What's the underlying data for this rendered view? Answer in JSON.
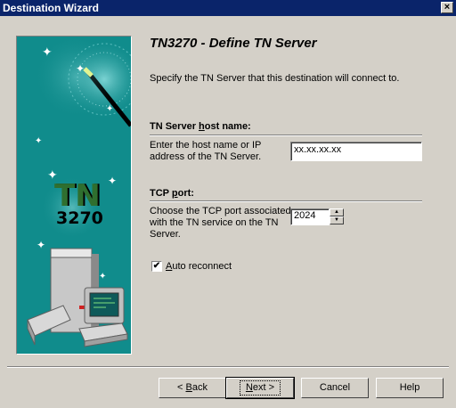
{
  "window": {
    "title": "Destination Wizard",
    "close_label": "×"
  },
  "page": {
    "heading": "TN3270 - Define TN Server",
    "intro": "Specify the TN Server that this destination will connect to."
  },
  "art": {
    "logo_line1": "TN",
    "logo_line2": "3270"
  },
  "host_section": {
    "title_pre": "TN Server ",
    "title_accel": "h",
    "title_post": "ost name:",
    "desc_line1": "Enter the host name or IP",
    "desc_line2": "address of the TN Server.",
    "value": "xx.xx.xx.xx"
  },
  "port_section": {
    "title_pre": "TCP ",
    "title_accel": "p",
    "title_post": "ort:",
    "desc_line1": "Choose the TCP port associated",
    "desc_line2": "with the TN service on the TN",
    "desc_line3": "Server.",
    "value": "2024"
  },
  "auto_reconnect": {
    "checked": true,
    "label_accel": "A",
    "label_rest": "uto reconnect"
  },
  "buttons": {
    "back_arrow": "< ",
    "back_accel": "B",
    "back_rest": "ack",
    "next_accel": "N",
    "next_rest": "ext >",
    "cancel": "Cancel",
    "help": "Help"
  }
}
